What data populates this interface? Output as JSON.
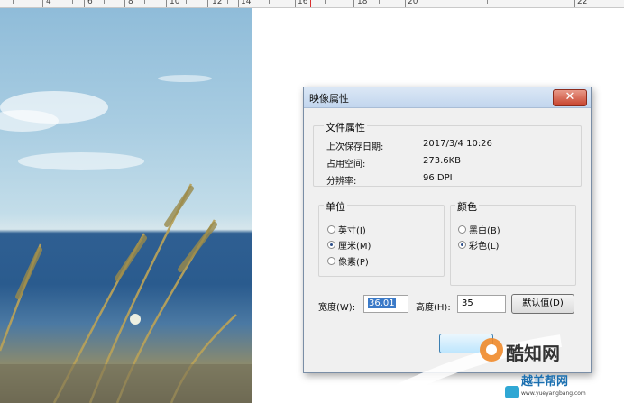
{
  "ruler": {
    "numbers": [
      "4",
      "6",
      "8",
      "10",
      "12",
      "14",
      "16",
      "18",
      "20",
      "22"
    ]
  },
  "dialog": {
    "title": "映像属性",
    "close_glyph": "✕",
    "file_props": {
      "legend": "文件属性",
      "rows": [
        {
          "label": "上次保存日期:",
          "value": "2017/3/4 10:26"
        },
        {
          "label": "占用空间:",
          "value": "273.6KB"
        },
        {
          "label": "分辨率:",
          "value": "96 DPI"
        }
      ]
    },
    "units": {
      "legend": "单位",
      "options": [
        {
          "label": "英寸(I)",
          "checked": false
        },
        {
          "label": "厘米(M)",
          "checked": true
        },
        {
          "label": "像素(P)",
          "checked": false
        }
      ]
    },
    "color": {
      "legend": "颜色",
      "options": [
        {
          "label": "黑白(B)",
          "checked": false
        },
        {
          "label": "彩色(L)",
          "checked": true
        }
      ]
    },
    "width_label": "宽度(W):",
    "width_value": "36.01",
    "height_label": "高度(H):",
    "height_value": "35",
    "default_button": "默认值(D)"
  },
  "watermark": {
    "brand": "酷知网",
    "site_name": "越羊帮网",
    "url": "www.yueyangbang.com"
  },
  "colors": {
    "titlebar": "#c2d6ee",
    "close": "#c8452f",
    "selection": "#3b7ac8"
  }
}
